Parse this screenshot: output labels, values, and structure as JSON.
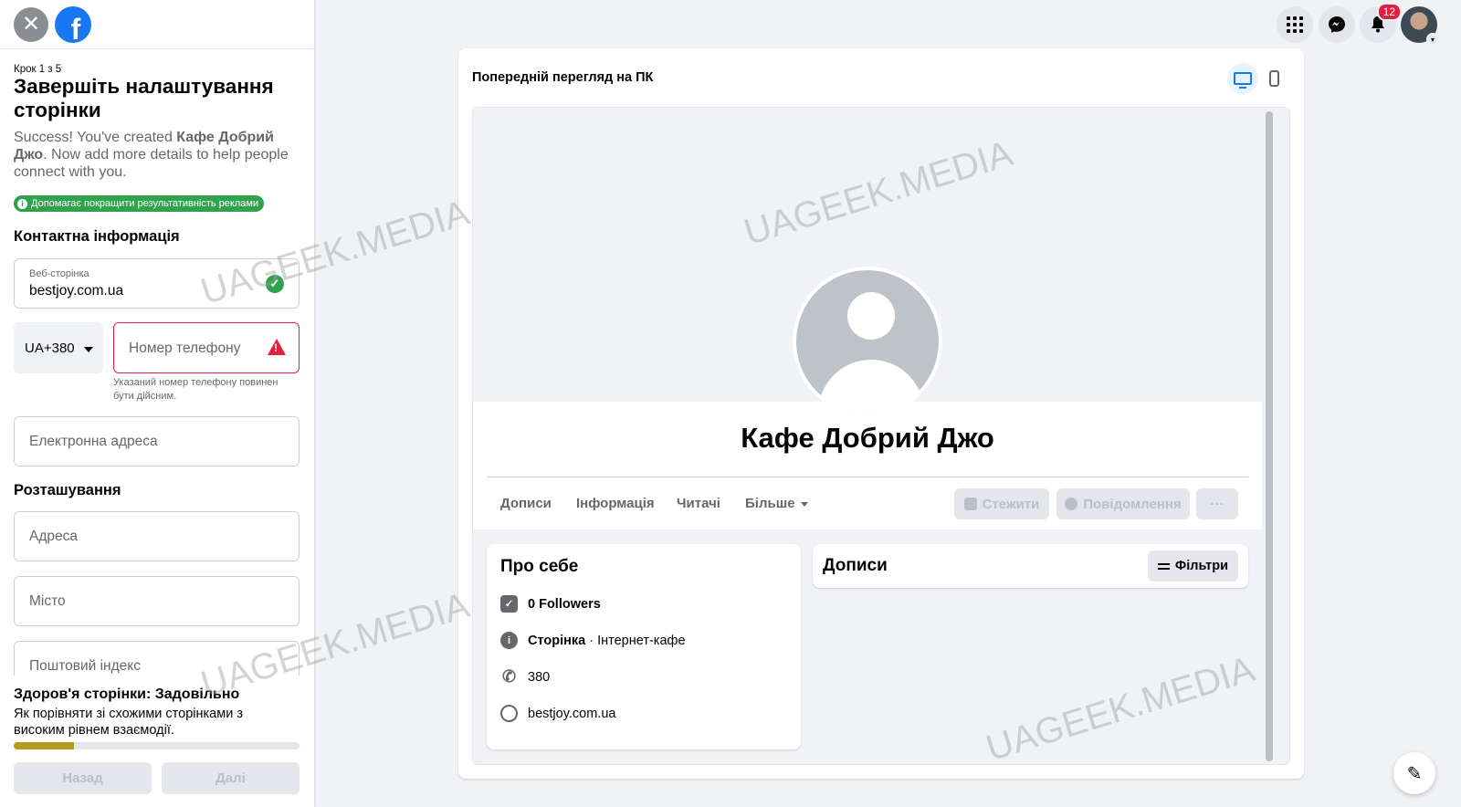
{
  "wizard": {
    "close_icon": "close-icon",
    "logo_icon": "facebook-logo",
    "step": "Крок 1 з 5",
    "title": "Завершіть налаштування сторінки",
    "success_prefix": "Success! You've created ",
    "success_name": "Кафе Добрий Джо",
    "success_suffix": ". Now add more details to help people connect with you.",
    "ads_badge": "Допомагає покращити результативність реклами",
    "contact_heading": "Контактна інформація",
    "website_label": "Веб-сторінка",
    "website_value": "bestjoy.com.ua",
    "country_code": "UA+380",
    "phone_placeholder": "Номер телефону",
    "phone_error": "Указаний номер телефону повинен бути дійсним.",
    "email_placeholder": "Електронна адреса",
    "location_heading": "Розташування",
    "address_placeholder": "Адреса",
    "city_placeholder": "Місто",
    "zip_placeholder": "Поштовий індекс",
    "health_title": "Здоров'я сторінки: Задовільно",
    "health_desc": "Як порівняти зі схожими сторінками з високим рівнем взаємодії.",
    "health_progress": 0.21,
    "back_label": "Назад",
    "next_label": "Далі"
  },
  "topbar": {
    "notifications_count": "12",
    "icons": [
      "menu-grid-icon",
      "messenger-icon",
      "bell-icon",
      "avatar"
    ]
  },
  "preview": {
    "title": "Попередній перегляд на ПК",
    "page_name": "Кафе Добрий Джо",
    "tabs": [
      "Дописи",
      "Інформація",
      "Читачі",
      "Більше"
    ],
    "follow_label": "Стежити",
    "message_label": "Повідомлення",
    "more_label": "···",
    "about": {
      "title": "Про себе",
      "followers": "0 Followers",
      "category_bold": "Сторінка",
      "category_rest": " · Інтернет-кафе",
      "phone": "380",
      "website": "bestjoy.com.ua"
    },
    "posts_title": "Дописи",
    "filters_label": "Фільтри"
  },
  "watermark": "UAGEEK.MEDIA",
  "colors": {
    "accent": "#1877f2",
    "success": "#31a24c",
    "error": "#e41e3f",
    "health": "#b29b1f"
  }
}
